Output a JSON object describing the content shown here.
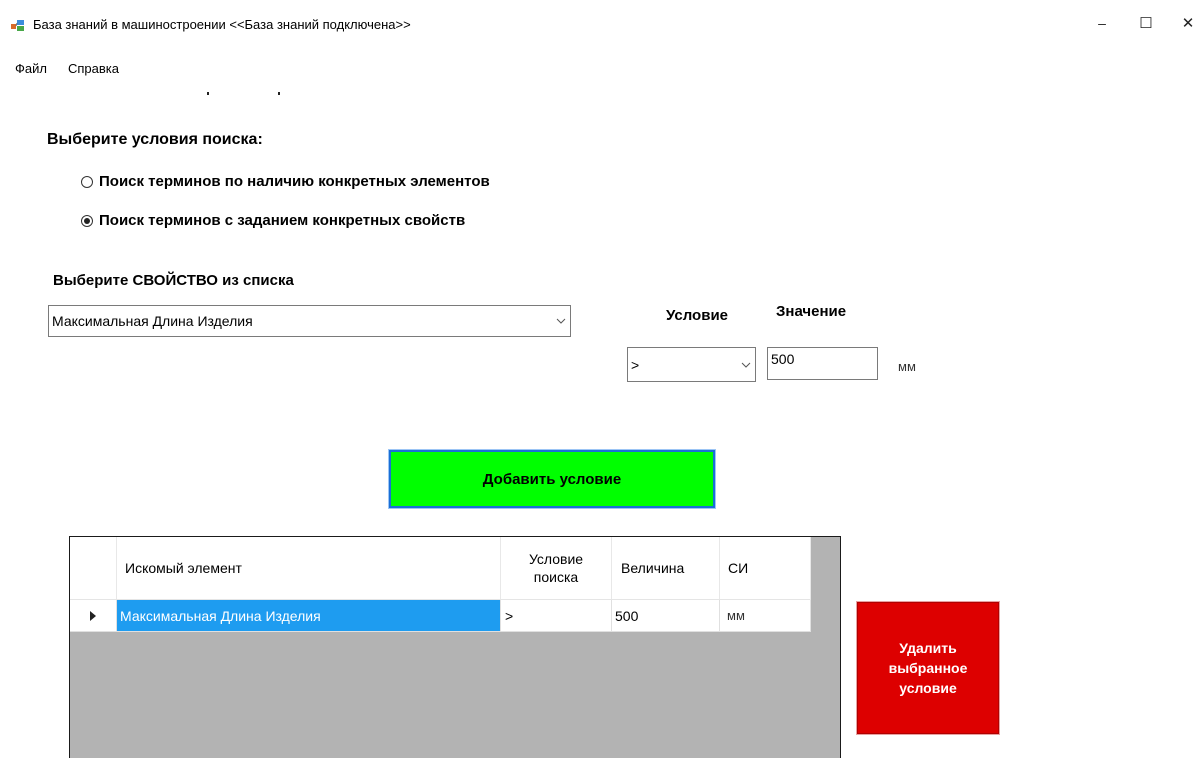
{
  "window": {
    "title": "База знаний в машиностроении  <<База знаний подключена>>",
    "min_glyph": "–",
    "max_glyph": "☐",
    "close_glyph": "✕",
    "icon": "app-icon"
  },
  "menu": {
    "items": [
      "Файл",
      "Справка"
    ]
  },
  "search": {
    "heading": "Выберите условия поиска:",
    "options": [
      {
        "label": "Поиск терминов по наличию конкретных элементов",
        "selected": false
      },
      {
        "label": "Поиск терминов с заданием конкретных свойств",
        "selected": true
      }
    ]
  },
  "property": {
    "label": "Выберите  СВОЙСТВО из списка",
    "selected": "Максимальная Длина Изделия"
  },
  "condition": {
    "label": "Условие",
    "selected": ">"
  },
  "value": {
    "label": "Значение",
    "current": "500",
    "unit": "мм"
  },
  "add_button": {
    "label": "Добавить условие",
    "color": "#00ff00"
  },
  "grid": {
    "columns": [
      "Искомый элемент",
      "Условие",
      "поиска",
      "Величина",
      "СИ"
    ],
    "rows": [
      {
        "element": "Максимальная Длина Изделия",
        "condition": ">",
        "value": "500",
        "unit": "мм",
        "selected": true
      }
    ],
    "selection_color": "#1e9cf0"
  },
  "delete_button": {
    "lines": [
      "Удалить",
      "выбранное",
      "условие"
    ],
    "color": "#dd0000"
  }
}
